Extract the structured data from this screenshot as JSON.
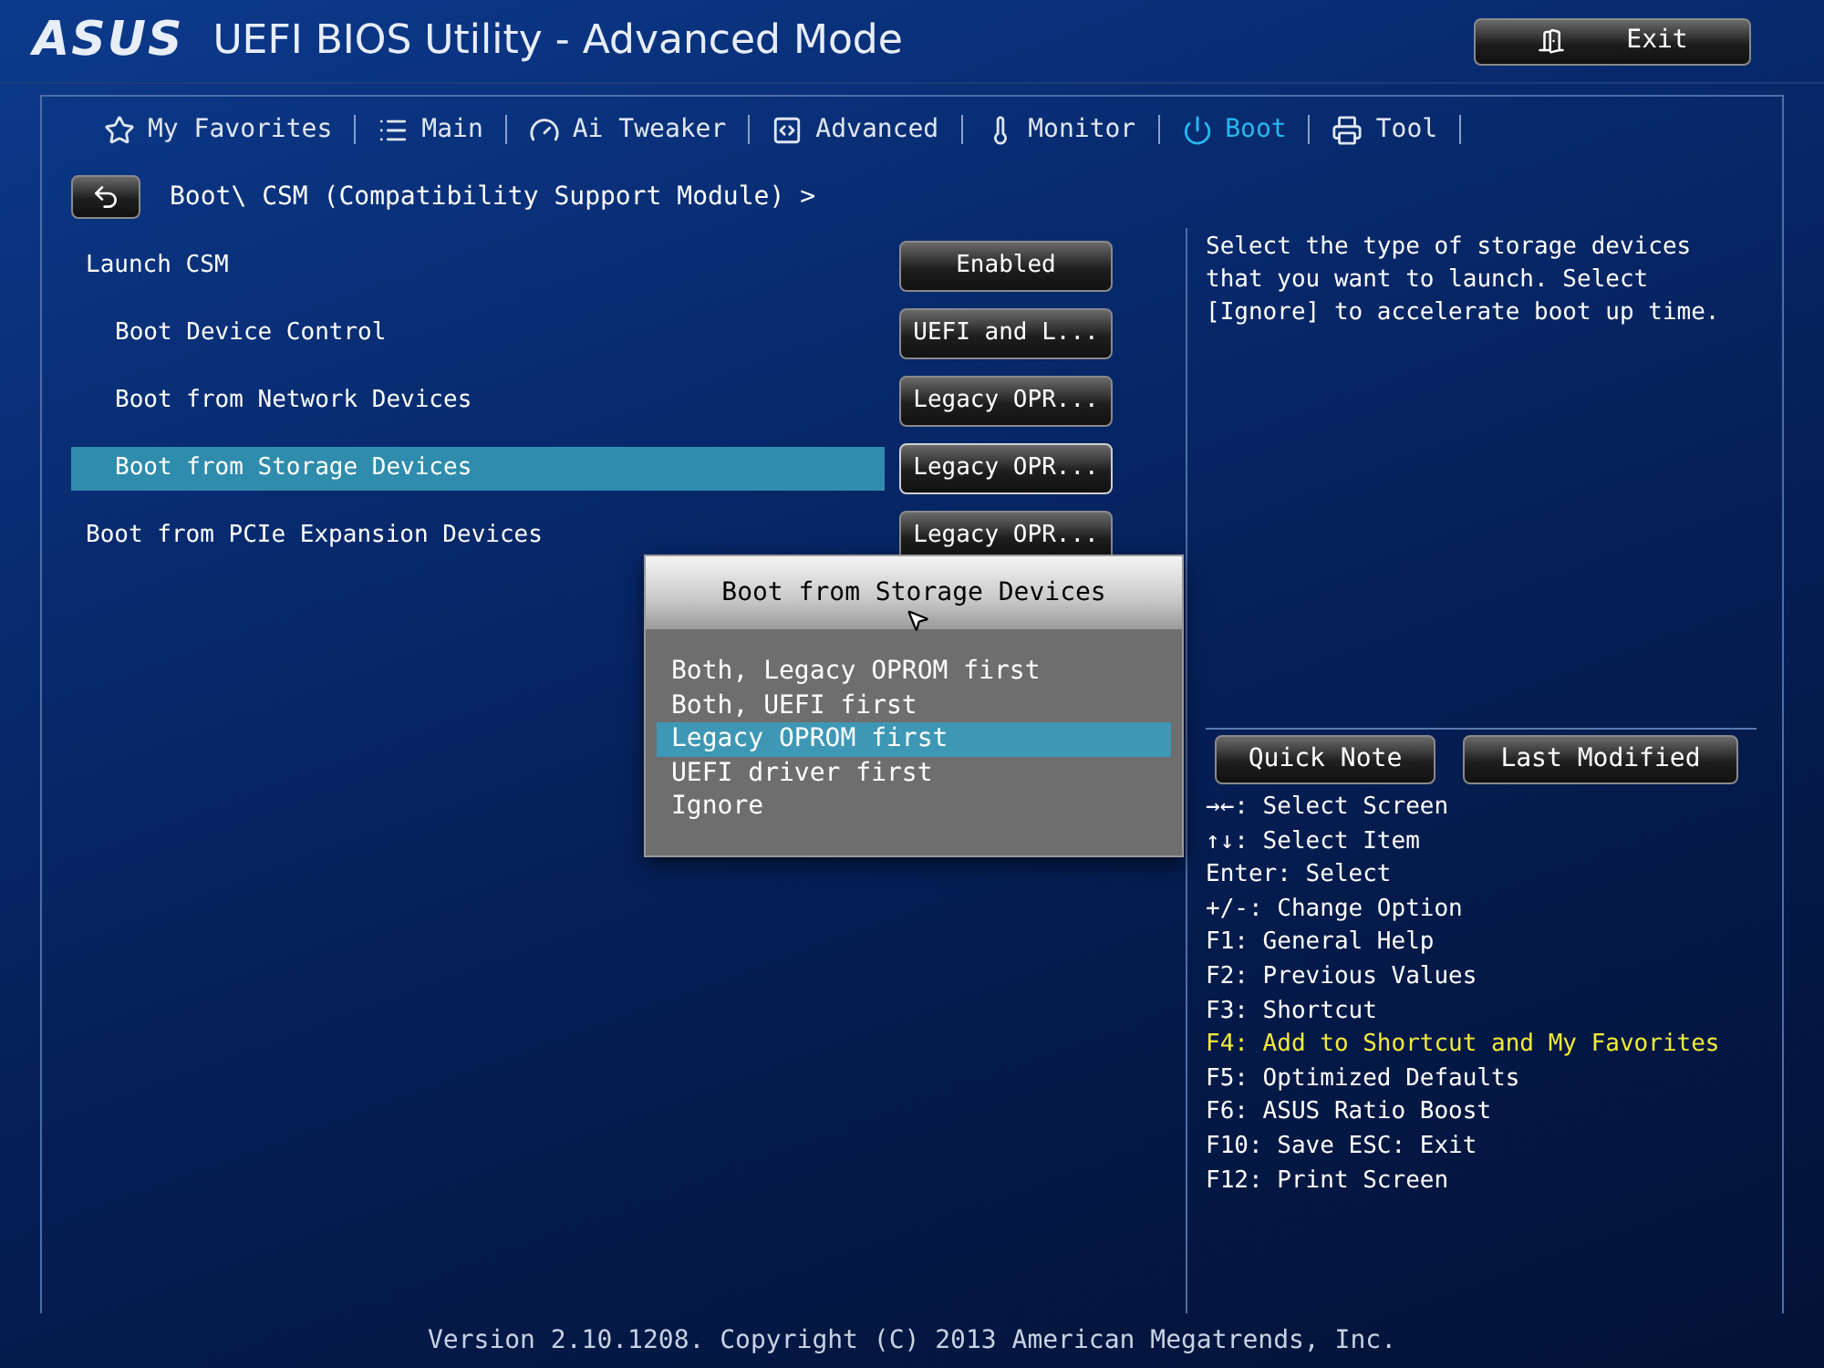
{
  "header": {
    "logo": "ASUS",
    "title": "UEFI BIOS Utility - Advanced Mode",
    "exit_button": "Exit"
  },
  "tabs": [
    {
      "label": "My Favorites",
      "selected": false
    },
    {
      "label": "Main",
      "selected": false
    },
    {
      "label": "Ai Tweaker",
      "selected": false
    },
    {
      "label": "Advanced",
      "selected": false
    },
    {
      "label": "Monitor",
      "selected": false
    },
    {
      "label": "Boot",
      "selected": true
    },
    {
      "label": "Tool",
      "selected": false
    }
  ],
  "breadcrumb": "Boot\\ CSM (Compatibility Support Module) >",
  "settings": [
    {
      "label": "Launch CSM",
      "value": "Enabled",
      "selected": false,
      "children": [
        {
          "label": "Boot Device Control",
          "value": "UEFI and L...",
          "selected": false
        },
        {
          "label": "Boot from Network Devices",
          "value": "Legacy OPR...",
          "selected": false
        },
        {
          "label": "Boot from Storage Devices",
          "value": "Legacy OPR...",
          "selected": true
        }
      ]
    },
    {
      "label": "Boot from PCIe Expansion Devices",
      "value": "Legacy OPR...",
      "selected": false
    }
  ],
  "popup": {
    "title": "Boot from Storage Devices",
    "options": [
      {
        "label": "Both, Legacy OPROM first",
        "selected": false
      },
      {
        "label": "Both, UEFI first",
        "selected": false
      },
      {
        "label": "Legacy OPROM first",
        "selected": true
      },
      {
        "label": "UEFI driver first",
        "selected": false
      },
      {
        "label": "Ignore",
        "selected": false
      }
    ]
  },
  "help_text": "Select the type of storage devices that you want to launch. Select [Ignore] to accelerate boot up time.",
  "buttons": [
    "Quick Note",
    "Last Modified"
  ],
  "key_help": [
    {
      "text": "→←: Select Screen",
      "highlighted": false
    },
    {
      "text": "↑↓: Select Item",
      "highlighted": false
    },
    {
      "text": "Enter: Select",
      "highlighted": false
    },
    {
      "text": "+/-: Change Option",
      "highlighted": false
    },
    {
      "text": "F1: General Help",
      "highlighted": false
    },
    {
      "text": "F2: Previous Values",
      "highlighted": false
    },
    {
      "text": "F3: Shortcut",
      "highlighted": false
    },
    {
      "text": "F4: Add to Shortcut and My Favorites",
      "highlighted": true
    },
    {
      "text": "F5: Optimized Defaults",
      "highlighted": false
    },
    {
      "text": "F6: ASUS Ratio Boost",
      "highlighted": false
    },
    {
      "text": "F10: Save  ESC: Exit",
      "highlighted": false
    },
    {
      "text": "F12: Print Screen",
      "highlighted": false
    }
  ],
  "footer": "Version 2.10.1208. Copyright (C) 2013 American Megatrends, Inc."
}
